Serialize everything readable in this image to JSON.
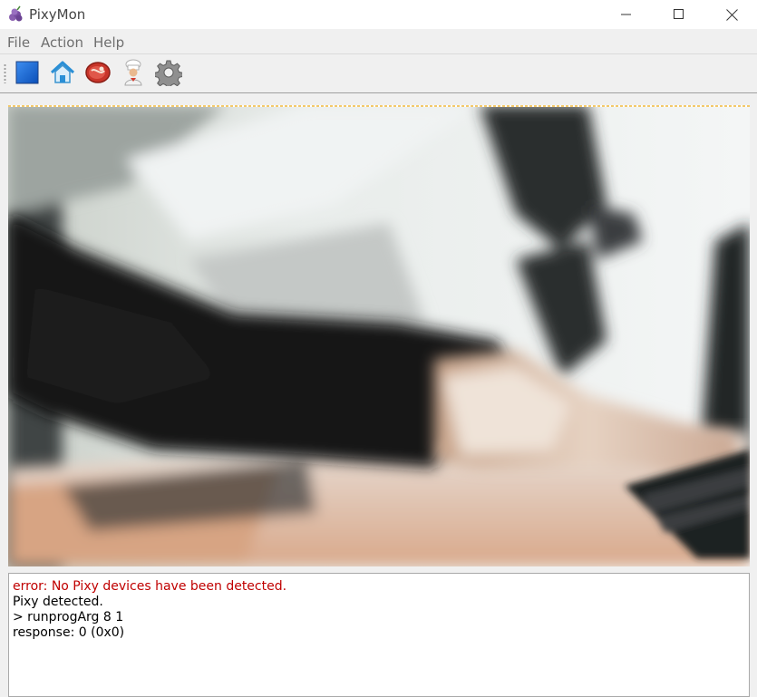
{
  "window": {
    "title": "PixyMon",
    "icons": {
      "app": "pixy-grape-icon",
      "minimize": "minimize-icon",
      "maximize": "maximize-icon",
      "close": "close-icon"
    }
  },
  "menu": {
    "items": [
      {
        "label": "File"
      },
      {
        "label": "Action"
      },
      {
        "label": "Help"
      }
    ]
  },
  "toolbar": {
    "buttons": [
      {
        "icon": "stop-square-icon"
      },
      {
        "icon": "home-icon"
      },
      {
        "icon": "raw-video-meat-icon"
      },
      {
        "icon": "cooked-video-chef-icon"
      },
      {
        "icon": "settings-gear-icon"
      }
    ]
  },
  "video": {
    "description_icon": "camera-feed"
  },
  "console": {
    "lines": [
      {
        "text": "error: No Pixy devices have been detected.",
        "color": "#c00000"
      },
      {
        "text": "Pixy detected.",
        "color": "#000000"
      },
      {
        "text": "> runprogArg 8 1",
        "color": "#000000"
      },
      {
        "text": "response: 0 (0x0)",
        "color": "#000000"
      }
    ]
  }
}
